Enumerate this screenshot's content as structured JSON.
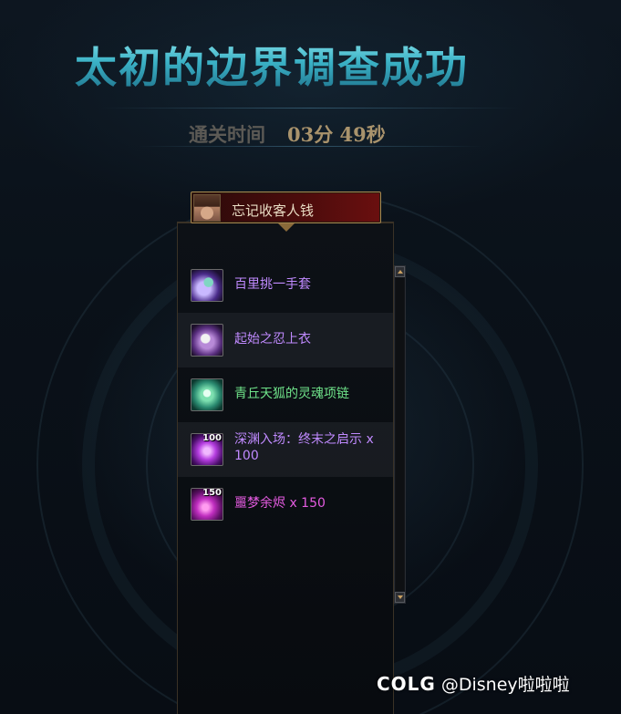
{
  "title": "太初的边界调查成功",
  "clear_time": {
    "label": "通关时间",
    "value": "03分 49秒"
  },
  "player": {
    "name": "忘记收客人钱"
  },
  "items": [
    {
      "name": "百里挑一手套",
      "color": "#c08aff",
      "icon": "gauntlet-icon",
      "count": ""
    },
    {
      "name": "起始之忍上衣",
      "color": "#c08aff",
      "icon": "shirt-icon",
      "count": ""
    },
    {
      "name": "青丘天狐的灵魂项链",
      "color": "#6fe38a",
      "icon": "necklace-icon",
      "count": ""
    },
    {
      "name": "深渊入场：终末之启示 x 100",
      "color": "#c08aff",
      "icon": "orb-icon",
      "count": "100"
    },
    {
      "name": "噩梦余烬 x 150",
      "color": "#e45be0",
      "icon": "ember-icon",
      "count": "150"
    }
  ],
  "watermark": {
    "logo": "COLG",
    "handle": "@Disney啦啦啦"
  }
}
